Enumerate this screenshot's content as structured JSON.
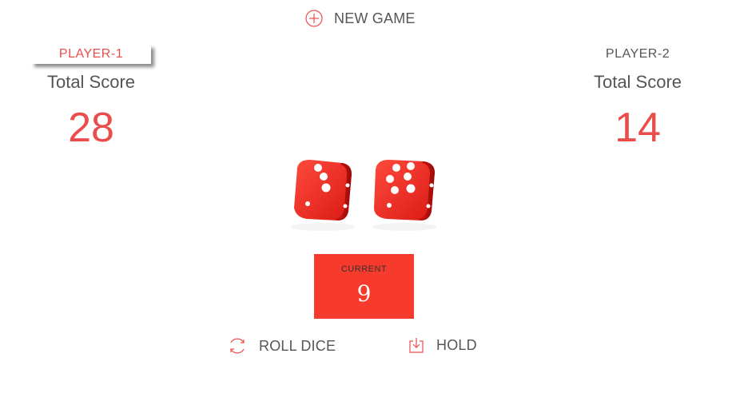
{
  "buttons": {
    "new_game": "NEW GAME",
    "roll_dice": "ROLL DICE",
    "hold": "HOLD",
    "new_game_icon": "plus-circle-icon",
    "roll_icon": "refresh-icon",
    "hold_icon": "download-tray-icon"
  },
  "players": [
    {
      "name": "PLAYER-1",
      "total_label": "Total Score",
      "score": "28",
      "active": true
    },
    {
      "name": "PLAYER-2",
      "total_label": "Total Score",
      "score": "14",
      "active": false
    }
  ],
  "dice": [
    {
      "value": 3
    },
    {
      "value": 6
    }
  ],
  "current": {
    "label": "CURRENT",
    "score": "9"
  },
  "colors": {
    "accent": "#EB4D4D",
    "current_bg": "#F63A2C",
    "dice_red": "#E8201C",
    "text": "#555555"
  }
}
